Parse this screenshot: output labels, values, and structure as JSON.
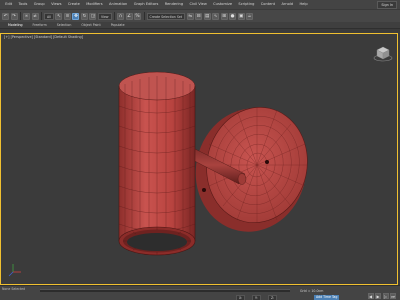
{
  "menubar": {
    "items": [
      "Edit",
      "Tools",
      "Group",
      "Views",
      "Create",
      "Modifiers",
      "Animation",
      "Graph Editors",
      "Rendering",
      "Civil View",
      "Customize",
      "Scripting",
      "Content",
      "Arnold",
      "Help"
    ],
    "search_label": "Sign In",
    "colors": {
      "background": "#444444",
      "text": "#d8d8d8"
    }
  },
  "toolbar": {
    "filter_dropdown": "All",
    "view_dropdown": "View",
    "selection_set_dropdown": "Create Selection Set",
    "icons": [
      "undo-icon",
      "redo-icon",
      "link-icon",
      "unlink-icon",
      "select-icon",
      "select-name-icon",
      "move-icon",
      "rotate-icon",
      "scale-icon",
      "snap-icon",
      "angle-snap-icon",
      "mirror-icon",
      "align-icon",
      "render-icon"
    ]
  },
  "ribbon": {
    "tabs": [
      "Modeling",
      "Freeform",
      "Selection",
      "Object Paint",
      "Populate"
    ]
  },
  "viewport": {
    "label": "[+] [Perspective] [Standard] [Default Shading]",
    "background": "#3b3b3b",
    "border_color": "#f0c030",
    "object_color": "#c0504d",
    "wire_color": "#5a1a18"
  },
  "statusbar": {
    "selection_text": "None Selected",
    "frame_counter": "0 / 100",
    "x_label": "X:",
    "y_label": "Y:",
    "z_label": "Z:",
    "grid_text": "Grid = 10.0cm",
    "add_time_tag": "Add Time Tag",
    "auto_key": "Auto",
    "play_controls": [
      "prev-frame-icon",
      "play-icon",
      "next-frame-icon",
      "end-icon"
    ]
  }
}
